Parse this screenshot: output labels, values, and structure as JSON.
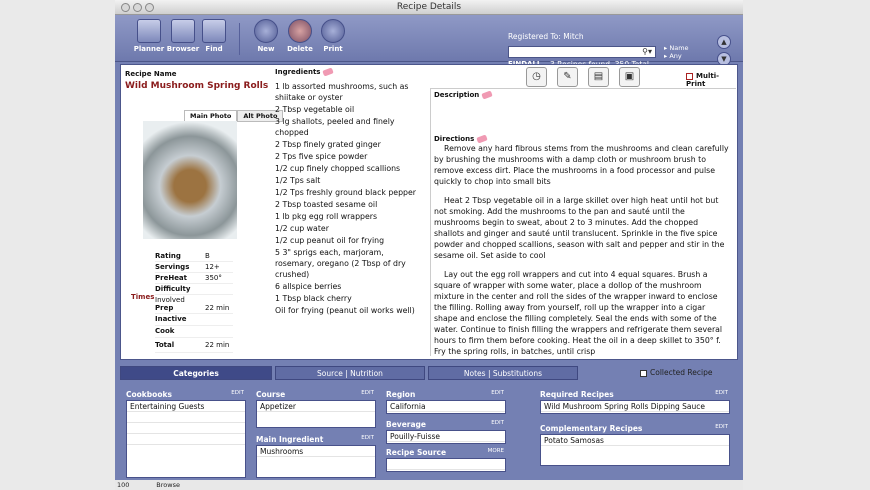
{
  "window": {
    "title": "Recipe Details"
  },
  "toolbar": {
    "planner": "Planner",
    "browser": "Browser",
    "find": "Find",
    "new": "New",
    "delete": "Delete",
    "print": "Print"
  },
  "search": {
    "registered": "Registered To: Mitch",
    "value": "",
    "findall": "FINDALL",
    "found": "3 Recipes found, 350 Total",
    "scope1": "Name",
    "scope2": "Any"
  },
  "recipe": {
    "name_label": "Recipe Name",
    "name": "Wild Mushroom Spring Rolls",
    "photo_tab1": "Main Photo",
    "photo_tab2": "Alt Photo",
    "stats": [
      {
        "label": "Rating",
        "value": "B"
      },
      {
        "label": "Servings",
        "value": "12+"
      },
      {
        "label": "PreHeat",
        "value": "350°"
      },
      {
        "label": "Difficulty",
        "value": "Involved"
      }
    ],
    "times_label": "Times",
    "times": [
      {
        "label": "Prep",
        "value": "22 min"
      },
      {
        "label": "Inactive",
        "value": ""
      },
      {
        "label": "Cook",
        "value": ""
      },
      {
        "label": "Total",
        "value": "22 min"
      }
    ],
    "ingredients_label": "Ingredients",
    "ingredients": [
      "1 lb assorted mushrooms, such as shiitake or oyster",
      "2 Tbsp vegetable oil",
      "3 lg shallots, peeled and finely chopped",
      "2 Tbsp finely grated ginger",
      "2 Tps five spice powder",
      "1/2 cup finely chopped scallions",
      "1/2 Tps salt",
      "1/2 Tps freshly ground black pepper",
      "2 Tbsp toasted sesame oil",
      "1 lb pkg egg roll wrappers",
      "1/2 cup water",
      "1/2 cup peanut oil for frying",
      "5 3\" sprigs each, marjoram, rosemary, oregano (2 Tbsp of dry crushed)",
      "6 allspice berries",
      "1 Tbsp black cherry",
      "Oil for frying (peanut oil works well)"
    ],
    "description_label": "Description",
    "directions_label": "Directions",
    "directions": [
      "Remove any hard fibrous stems from the mushrooms and clean carefully by brushing the mushrooms with a damp cloth or mushroom brush to remove excess dirt. Place the mushrooms in a food processor and pulse quickly to chop into small bits",
      "Heat 2 Tbsp vegetable oil in a large skillet over high heat until hot but not smoking. Add the mushrooms to the pan and sauté until the mushrooms begin to sweat, about 2 to 3 minutes. Add the chopped shallots and ginger and sauté until translucent. Sprinkle in the five spice powder and chopped scallions, season with salt and pepper and stir in the sesame oil. Set aside to cool",
      "Lay out the egg roll wrappers and cut into 4 equal squares. Brush a square of wrapper with some water, place a dollop of the mushroom mixture in the center and roll the sides of the wrapper inward to enclose the filling. Rolling away from yourself, roll up the wrapper into a cigar shape and enclose the filling completely. Seal the ends with some of the water. Continue to finish filling the wrappers and refrigerate them several hours to firm them before cooking. Heat the oil in a deep skillet to 350° f. Fry the spring rolls, in batches, until crisp"
    ],
    "multiprint": "Multi-Print"
  },
  "tabs": {
    "categories": "Categories",
    "source": "Source | Nutrition",
    "notes": "Notes | Substitutions",
    "collected": "Collected Recipe"
  },
  "categories": {
    "edit": "EDIT",
    "cookbooks_label": "Cookbooks",
    "cookbooks": [
      "Entertaining Guests"
    ],
    "course_label": "Course",
    "course": [
      "Appetizer"
    ],
    "main_label": "Main Ingredient",
    "main": [
      "Mushrooms"
    ],
    "region_label": "Region",
    "region": [
      "California"
    ],
    "beverage_label": "Beverage",
    "beverage": [
      "Pouilly-Fuisse"
    ],
    "source_label": "Recipe Source",
    "source_more": "MORE",
    "required_label": "Required Recipes",
    "required": [
      "Wild Mushroom Spring Rolls Dipping Sauce"
    ],
    "complementary_label": "Complementary Recipes",
    "complementary": [
      "Potato Samosas"
    ]
  },
  "status": {
    "zoom": "100",
    "mode": "Browse"
  }
}
